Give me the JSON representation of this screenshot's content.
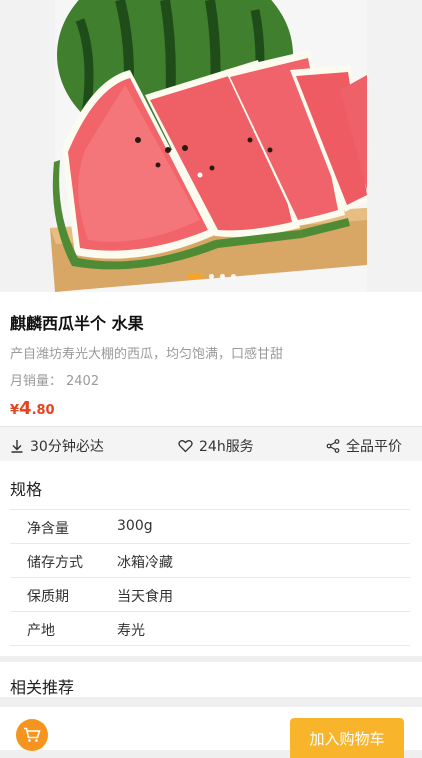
{
  "product": {
    "title": "麒麟西瓜半个 水果",
    "description": "产自潍坊寿光大棚的西瓜，均匀饱满，口感甘甜",
    "sales_label": "月销量：",
    "sales_value": "2402",
    "price": {
      "currency": "¥",
      "integer": "4",
      "decimal": ".80"
    },
    "carousel": {
      "total": 4,
      "active": 1
    }
  },
  "services": [
    {
      "label": "30分钟必达",
      "icon": "download-icon"
    },
    {
      "label": "24h服务",
      "icon": "heart-icon"
    },
    {
      "label": "全品平价",
      "icon": "share-icon"
    }
  ],
  "spec": {
    "title": "规格",
    "rows": [
      {
        "key": "净含量",
        "value": "300g"
      },
      {
        "key": "储存方式",
        "value": "冰箱冷藏"
      },
      {
        "key": "保质期",
        "value": "当天食用"
      },
      {
        "key": "产地",
        "value": "寿光"
      }
    ]
  },
  "recommend": {
    "title": "相关推荐"
  },
  "bottom_bar": {
    "add_to_cart": "加入购物车",
    "cart_icon": "cart-icon"
  },
  "colors": {
    "price": "#e5421f",
    "accent": "#f5941e",
    "button": "#f8b52c"
  }
}
